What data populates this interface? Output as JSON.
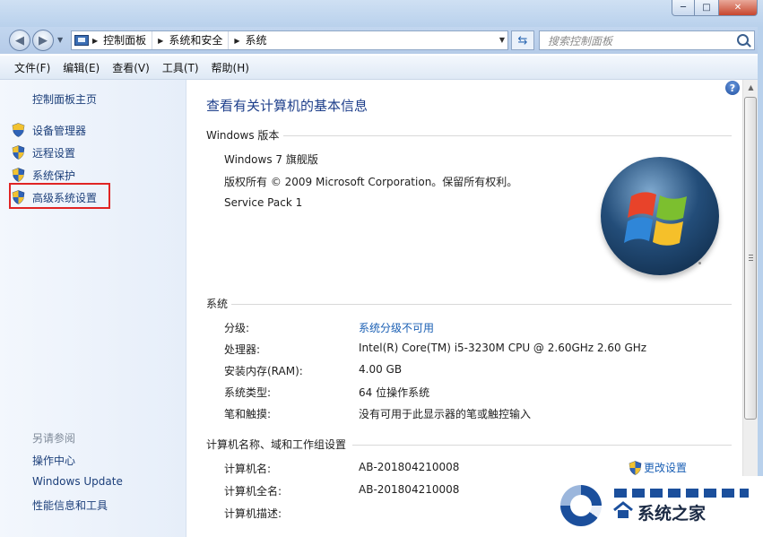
{
  "window": {
    "minimize_label": "─",
    "maximize_label": "□",
    "close_label": "✕"
  },
  "address_bar": {
    "breadcrumbs": [
      "控制面板",
      "系统和安全",
      "系统"
    ]
  },
  "search": {
    "placeholder": "搜索控制面板"
  },
  "menu": [
    "文件(F)",
    "编辑(E)",
    "查看(V)",
    "工具(T)",
    "帮助(H)"
  ],
  "left_pane": {
    "home": "控制面板主页",
    "tasks": [
      {
        "label": "设备管理器",
        "icon": "uac-shield-icon"
      },
      {
        "label": "远程设置",
        "icon": "uac-shield-icon"
      },
      {
        "label": "系统保护",
        "icon": "uac-shield-icon"
      },
      {
        "label": "高级系统设置",
        "icon": "uac-shield-icon",
        "highlighted": true
      }
    ],
    "see_also_title": "另请参阅",
    "see_also": [
      "操作中心",
      "Windows Update",
      "性能信息和工具"
    ]
  },
  "main": {
    "title": "查看有关计算机的基本信息",
    "edition_section": {
      "heading": "Windows 版本",
      "edition": "Windows 7 旗舰版",
      "copyright": "版权所有 © 2009 Microsoft Corporation。保留所有权利。",
      "service_pack": "Service Pack 1"
    },
    "system_section": {
      "heading": "系统",
      "rows": [
        {
          "label": "分级:",
          "value": "系统分级不可用",
          "link": true
        },
        {
          "label": "处理器:",
          "value": "Intel(R) Core(TM) i5-3230M CPU @ 2.60GHz   2.60 GHz"
        },
        {
          "label": "安装内存(RAM):",
          "value": "4.00 GB"
        },
        {
          "label": "系统类型:",
          "value": "64 位操作系统"
        },
        {
          "label": "笔和触摸:",
          "value": "没有可用于此显示器的笔或触控输入"
        }
      ]
    },
    "computer_section": {
      "heading": "计算机名称、域和工作组设置",
      "change_label": "更改设置",
      "rows": [
        {
          "label": "计算机名:",
          "value": "AB-201804210008"
        },
        {
          "label": "计算机全名:",
          "value": "AB-201804210008"
        },
        {
          "label": "计算机描述:",
          "value": ""
        }
      ]
    }
  },
  "watermark": {
    "text": "系统之家"
  },
  "colors": {
    "accent_link": "#1a5fb4",
    "title_blue": "#1e3f8b",
    "highlight_red": "#e02424"
  }
}
